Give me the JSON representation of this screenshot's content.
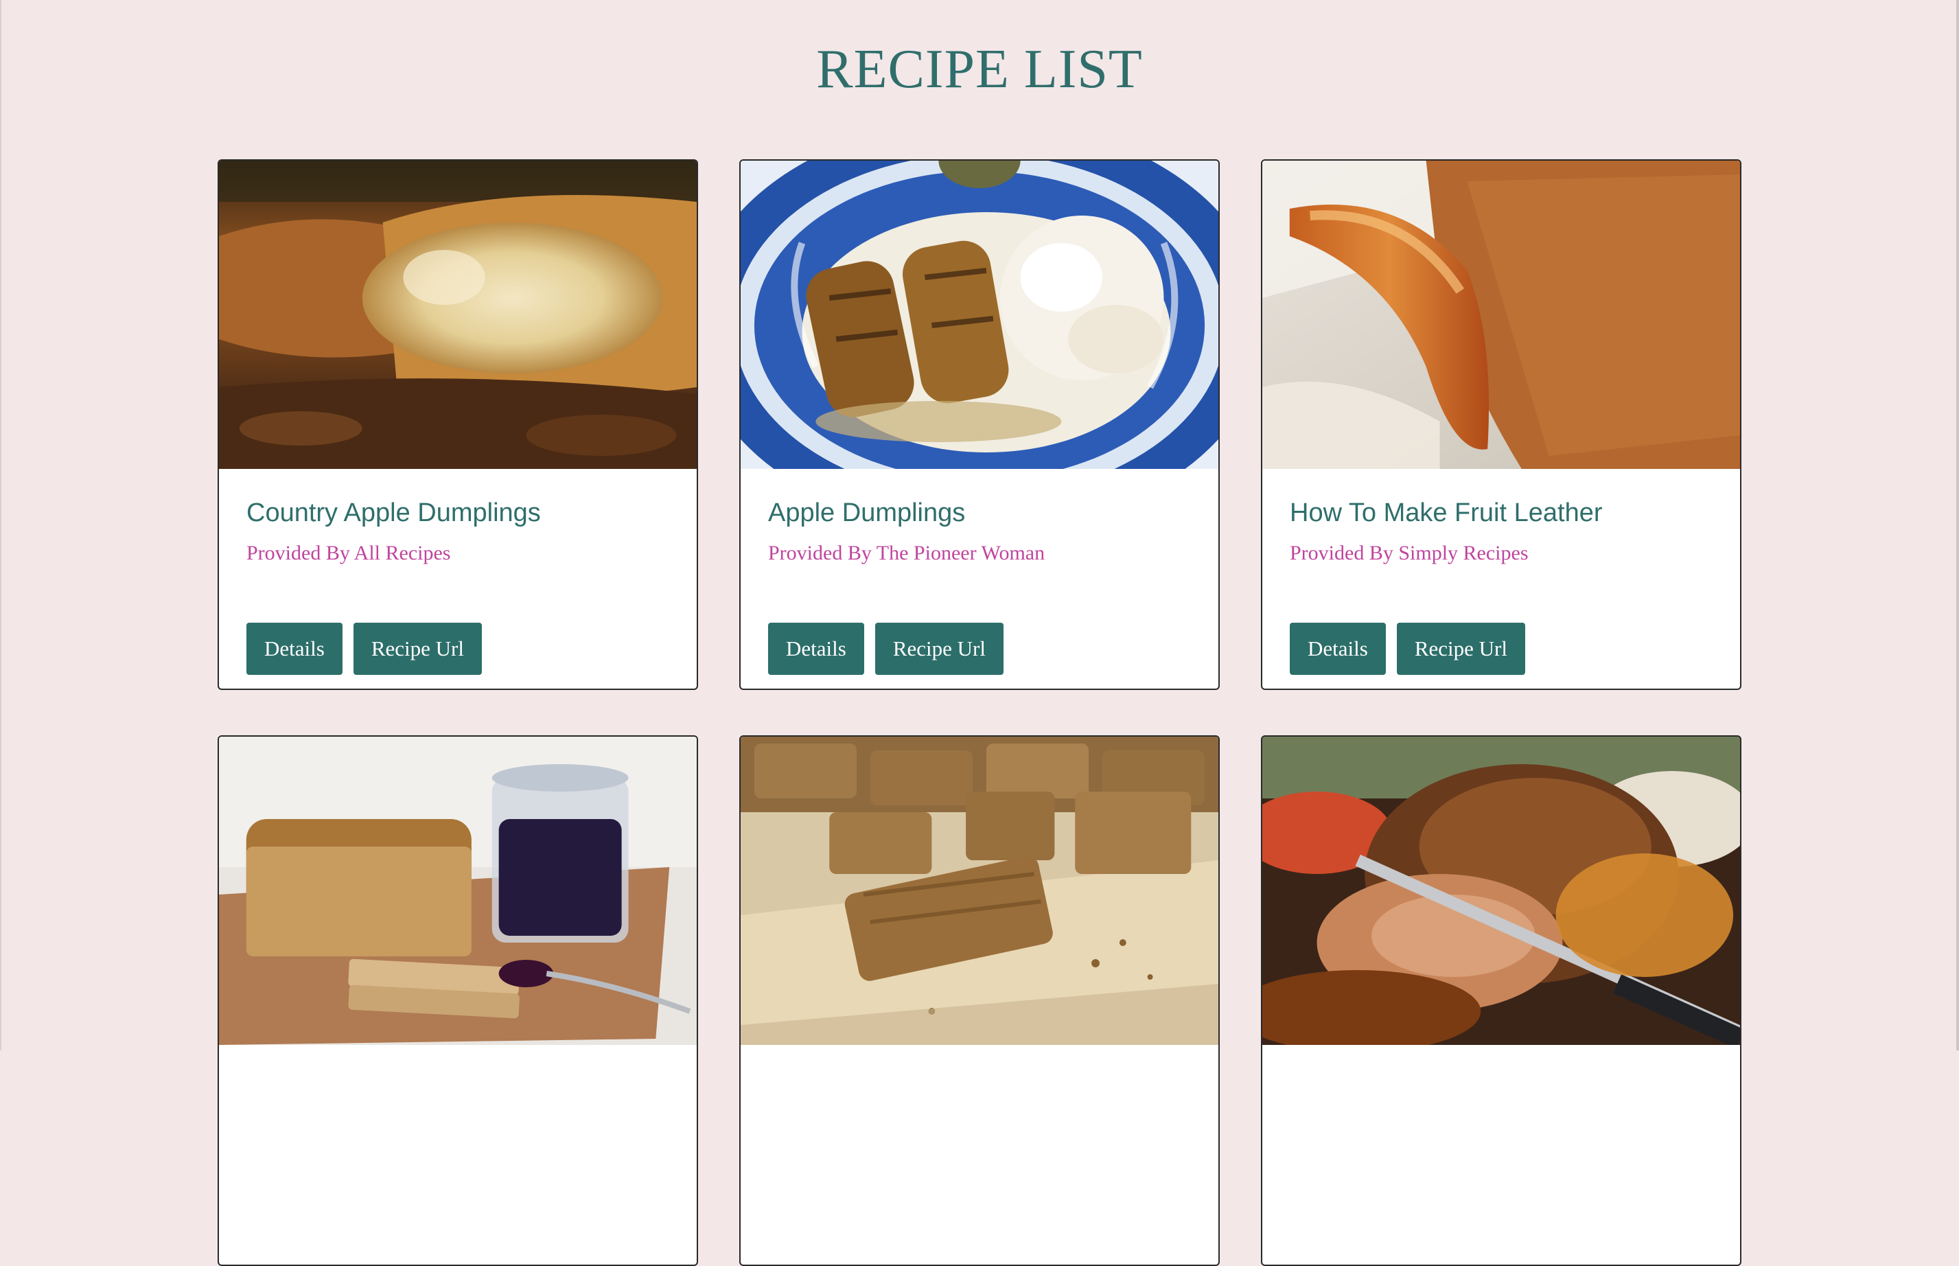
{
  "page": {
    "title": "RECIPE LIST",
    "accent_color": "#2f6e6b",
    "provider_color": "#c0449d",
    "background_color": "#f3e7e8"
  },
  "recipes": [
    {
      "title": "Country Apple Dumplings",
      "provider": "Provided By All Recipes",
      "image": "apple-dumpling-closeup-photo",
      "details_label": "Details",
      "url_label": "Recipe Url"
    },
    {
      "title": "Apple Dumplings",
      "provider": "Provided By The Pioneer Woman",
      "image": "apple-dumplings-blue-plate-photo",
      "details_label": "Details",
      "url_label": "Recipe Url"
    },
    {
      "title": "How To Make Fruit Leather",
      "provider": "Provided By Simply Recipes",
      "image": "fruit-leather-roll-photo",
      "details_label": "Details",
      "url_label": "Recipe Url"
    },
    {
      "title": "",
      "provider": "",
      "image": "bread-loaf-jam-jar-photo",
      "details_label": "",
      "url_label": ""
    },
    {
      "title": "",
      "provider": "",
      "image": "granola-bars-cutting-board-photo",
      "details_label": "",
      "url_label": ""
    },
    {
      "title": "",
      "provider": "",
      "image": "roast-pork-carving-photo",
      "details_label": "",
      "url_label": ""
    }
  ]
}
